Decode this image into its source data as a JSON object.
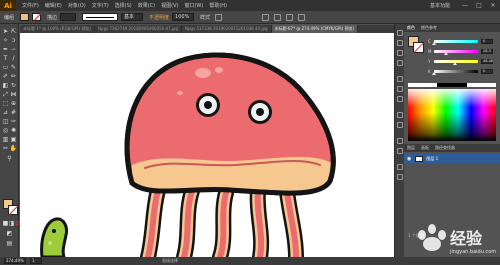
{
  "app": {
    "logo": "Ai",
    "menu": [
      "文件(F)",
      "编辑(E)",
      "对象(O)",
      "文字(T)",
      "选择(S)",
      "效果(C)",
      "视图(V)",
      "窗口(W)",
      "帮助(H)"
    ],
    "workspace": "基本功能",
    "window_buttons": [
      "—",
      "□",
      "✕"
    ]
  },
  "control_bar": {
    "selection_label": "编组",
    "stroke_label": "描边",
    "stroke_value": "",
    "brush_value": "基本",
    "opacity_label": "不透明度",
    "opacity_value": "100%",
    "style_label": "样式"
  },
  "document_tabs": [
    {
      "label": "未标题-1* @ 100% (RGB/GPU 预览)",
      "active": false
    },
    {
      "label": "Npgs 7362749 20180905000350 d7.jpg",
      "active": false
    },
    {
      "label": "Npgs 537338 2019020015261038 40.jpg",
      "active": false
    },
    {
      "label": "未标题-67* @ 274.49% (CMYK/GPU 预览)",
      "active": true
    }
  ],
  "status_bar": {
    "zoom": "274.49%",
    "page": "1",
    "tool": "直接选择"
  },
  "color_panel": {
    "tabs": [
      "颜色",
      "颜色参考"
    ],
    "fill_color": "#f6c78e",
    "sliders": [
      {
        "label": "C",
        "value": "0",
        "fraction": 0.0,
        "gradient": "linear-gradient(to right,#fff,#0ff)"
      },
      {
        "label": "M",
        "value": "28.3",
        "fraction": 0.28,
        "gradient": "linear-gradient(to right,#fff,#f0f)"
      },
      {
        "label": "Y",
        "value": "48.48",
        "fraction": 0.48,
        "gradient": "linear-gradient(to right,#fff,#ff0)"
      },
      {
        "label": "K",
        "value": "0",
        "fraction": 0.0,
        "gradient": "linear-gradient(to right,#fff,#000)"
      }
    ]
  },
  "layers_panel": {
    "tabs": [
      "图层",
      "画板",
      "路径查找器"
    ],
    "layer_name": "图层 1",
    "footer": "1 个图层"
  },
  "watermark": {
    "text": "经验",
    "subtext": "jingyan.baidu.com"
  },
  "colors": {
    "jelly_body": "#ec6b6e",
    "jelly_rim": "#f6c78e",
    "outline": "#141414",
    "tentacle": "#ec6b6e"
  }
}
